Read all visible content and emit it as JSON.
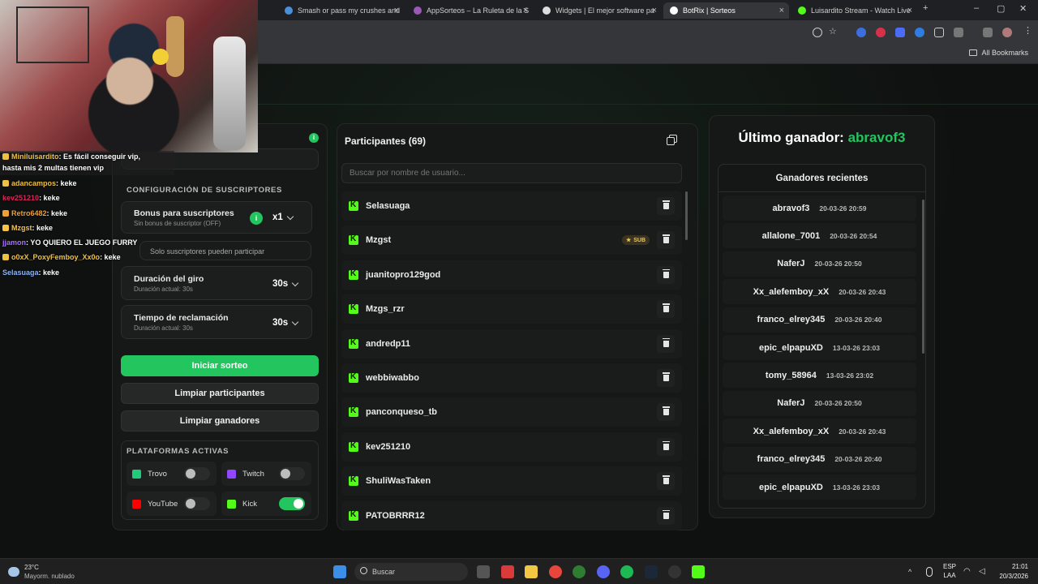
{
  "browser": {
    "tabs": [
      {
        "title": "Smash or pass my crushes and",
        "color": "#4a90d9"
      },
      {
        "title": "AppSorteos – La Ruleta de la S",
        "color": "#9b59b6"
      },
      {
        "title": "Widgets | El mejor software pa",
        "color": "#dddddd"
      },
      {
        "title": "BotRix | Sorteos",
        "color": "#ffffff"
      },
      {
        "title": "Luisardito Stream - Watch Live",
        "color": "#53fc18"
      }
    ],
    "new_tab": "+",
    "all_bookmarks": "All Bookmarks"
  },
  "settings": {
    "section_subs": "CONFIGURACIÓN DE SUSCRIPTORES",
    "bonus_title": "Bonus para suscriptores",
    "bonus_sub": "Sin bonus de suscriptor (OFF)",
    "bonus_value": "x1",
    "only_subs": "Solo suscriptores pueden participar",
    "spin_title": "Duración del giro",
    "spin_sub": "Duración actual: 30s",
    "spin_value": "30s",
    "claim_title": "Tiempo de reclamación",
    "claim_sub": "Duración actual: 30s",
    "claim_value": "30s",
    "start_btn": "Iniciar sorteo",
    "clear_participants_btn": "Limpiar participantes",
    "clear_winners_btn": "Limpiar ganadores",
    "section_platforms": "PLATAFORMAS ACTIVAS",
    "platforms": [
      {
        "name": "Trovo",
        "on": false,
        "color": "#1fcc7b"
      },
      {
        "name": "Twitch",
        "on": false,
        "color": "#9146ff"
      },
      {
        "name": "YouTube",
        "on": false,
        "color": "#ff0000"
      },
      {
        "name": "Kick",
        "on": true,
        "color": "#53fc18"
      }
    ]
  },
  "participants": {
    "title": "Participantes (69)",
    "search_placeholder": "Buscar por nombre de usuario...",
    "sub_badge": "SUB",
    "list": [
      "Selasuaga",
      "Mzgst",
      "juanitopro129god",
      "Mzgs_rzr",
      "andredp11",
      "webbiwabbo",
      "panconqueso_tb",
      "kev251210",
      "ShuliWasTaken",
      "PATOBRRR12"
    ]
  },
  "winners": {
    "last_label": "Último ganador:",
    "last_name": "abravof3",
    "recent_title": "Ganadores recientes",
    "list": [
      {
        "name": "abravof3",
        "date": "20-03-26 20:59"
      },
      {
        "name": "allalone_7001",
        "date": "20-03-26 20:54"
      },
      {
        "name": "NaferJ",
        "date": "20-03-26 20:50"
      },
      {
        "name": "Xx_alefemboy_xX",
        "date": "20-03-26 20:43"
      },
      {
        "name": "franco_elrey345",
        "date": "20-03-26 20:40"
      },
      {
        "name": "epic_elpapuXD",
        "date": "13-03-26 23:03"
      },
      {
        "name": "tomy_58964",
        "date": "13-03-26 23:02"
      },
      {
        "name": "NaferJ",
        "date": "20-03-26 20:50"
      },
      {
        "name": "Xx_alefemboy_xX",
        "date": "20-03-26 20:43"
      },
      {
        "name": "franco_elrey345",
        "date": "20-03-26 20:40"
      },
      {
        "name": "epic_elpapuXD",
        "date": "13-03-26 23:03"
      }
    ]
  },
  "chat": [
    {
      "user": "Miniluisardito",
      "msg": ": Es fácil conseguir vip,",
      "color": "#f0c040"
    },
    {
      "user": "",
      "msg": "hasta mis 2 multas tienen vip",
      "color": "#ffffff"
    },
    {
      "user": "adancampos",
      "msg": ": keke",
      "color": "#f0c040"
    },
    {
      "user": "kev251210",
      "msg": ": keke",
      "color": "#e0245e"
    },
    {
      "user": "Retro6482",
      "msg": ": keke",
      "color": "#f0a030"
    },
    {
      "user": "Mzgst",
      "msg": ": keke",
      "color": "#f6c344"
    },
    {
      "user": "jjamon",
      "msg": ": YO QUIERO EL JUEGO FURRY",
      "color": "#a970ff"
    },
    {
      "user": "o0xX_PoxyFemboy_Xx0o",
      "msg": ": keke",
      "color": "#f0c040"
    },
    {
      "user": "Selasuaga",
      "msg": ": keke",
      "color": "#8ab4f8"
    }
  ],
  "taskbar": {
    "temp": "23°C",
    "weather": "Mayorm. nublado",
    "search": "Buscar",
    "lang1": "ESP",
    "lang2": "LAA",
    "time": "21:01",
    "date": "20/3/2026"
  }
}
